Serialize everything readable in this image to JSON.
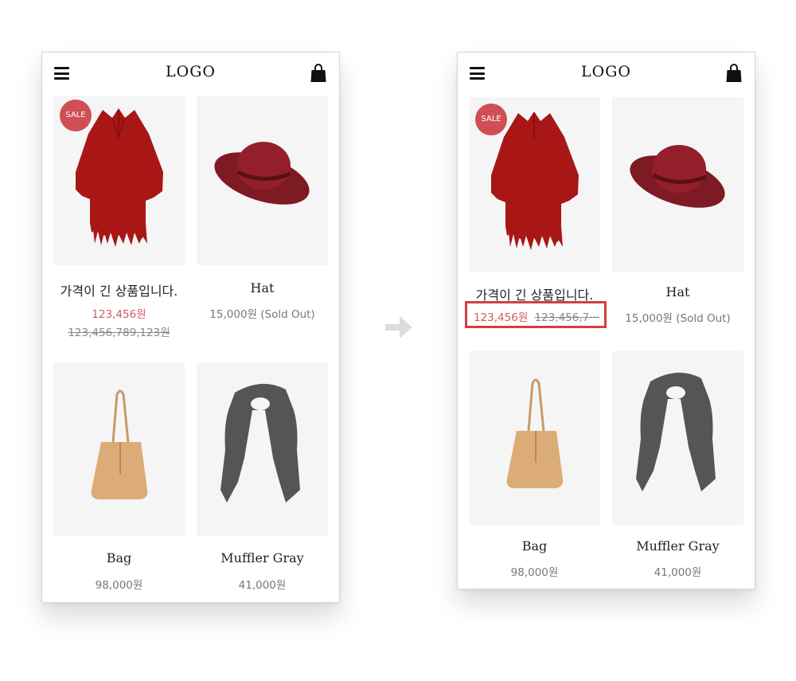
{
  "logo_text": "LOGO",
  "icons": {
    "menu": "hamburger-menu-icon",
    "cart": "shopping-bag-icon",
    "arrow": "arrow-right-icon"
  },
  "colors": {
    "sale_badge": "#cf4f55",
    "sale_price": "#d15b5f",
    "highlight_border": "#d0403e",
    "image_bg": "#f5f5f5"
  },
  "products": [
    {
      "name": "가격이 긴 상품입니다.",
      "sale_badge": "SALE",
      "price": "123,456원",
      "original_price": "123,456,789,123원",
      "image": "red-poncho"
    },
    {
      "name": "Hat",
      "price": "15,000원 (Sold Out)",
      "image": "burgundy-hat"
    },
    {
      "name": "Bag",
      "price": "98,000원",
      "image": "tan-leather-bag"
    },
    {
      "name": "Muffler Gray",
      "price": "41,000원",
      "image": "gray-muffler"
    }
  ],
  "after": {
    "truncated_original_price": "123,456,7···"
  }
}
